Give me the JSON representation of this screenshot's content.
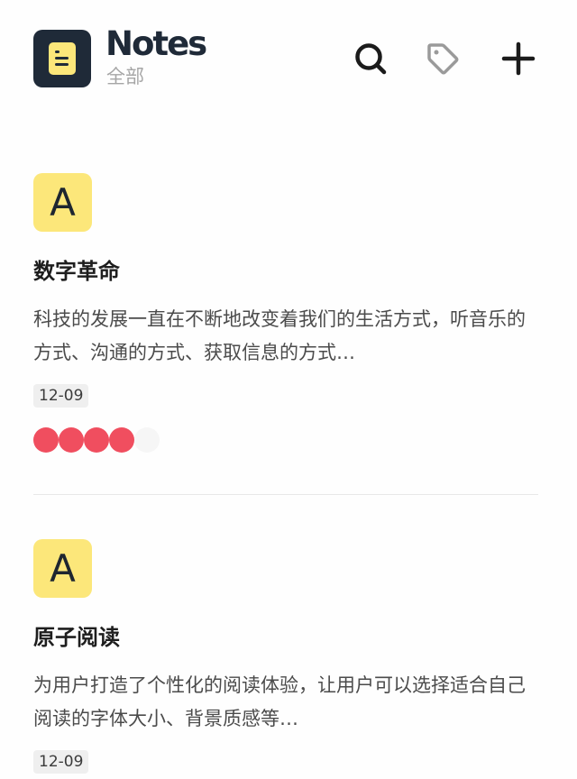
{
  "header": {
    "app_title": "Notes",
    "subtitle": "全部",
    "logo_icon": "document-icon",
    "actions": [
      "search-icon",
      "tag-icon",
      "plus-icon"
    ]
  },
  "notes": [
    {
      "avatar_letter": "A",
      "title": "数字革命",
      "excerpt": "科技的发展一直在不断地改变着我们的生活方式，听音乐的方式、沟通的方式、获取信息的方式…",
      "date": "12-09",
      "rating": 4,
      "rating_max": 5
    },
    {
      "avatar_letter": "A",
      "title": "原子阅读",
      "excerpt": "为用户打造了个性化的阅读体验，让用户可以选择适合自己阅读的字体大小、背景质感等…",
      "date": "12-09"
    }
  ],
  "colors": {
    "brand_dark": "#1f2a38",
    "avatar_yellow": "#fce77a",
    "rating_red": "#f04e5f"
  }
}
